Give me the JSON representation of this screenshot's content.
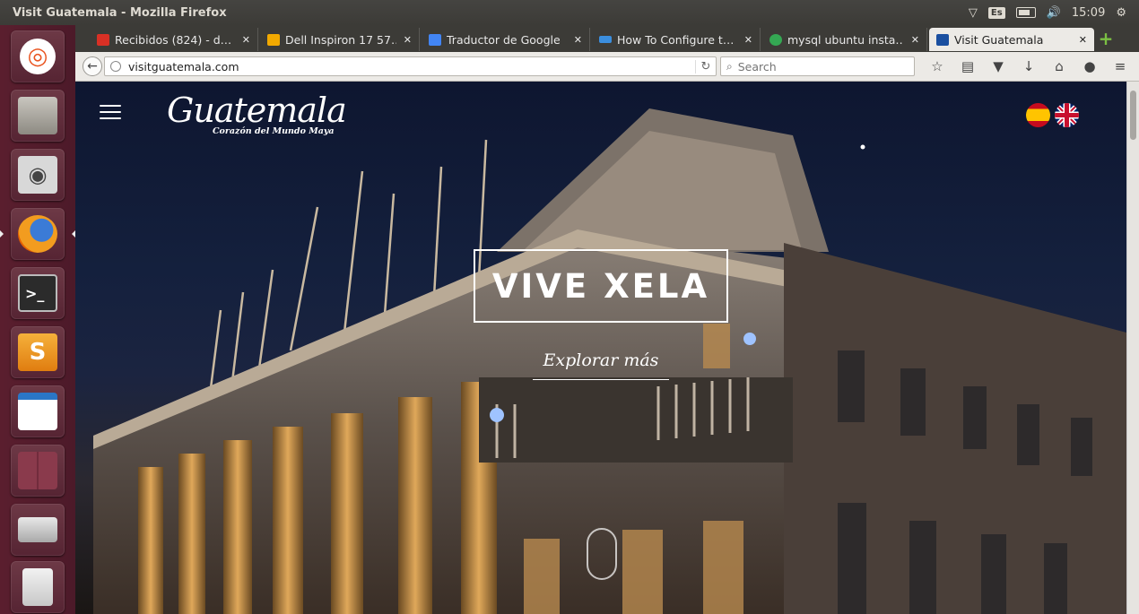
{
  "os": {
    "window_title": "Visit Guatemala - Mozilla Firefox",
    "keyboard_layout": "Es",
    "clock": "15:09",
    "launcher_colors": [
      "#e95420",
      "#8d8a82",
      "#d8d8d8",
      "#e66000",
      "#2b2b2b",
      "#f29c1f",
      "#2a76c6",
      "#8a3a4c",
      "#cfcfcf",
      "#e5e5e5"
    ]
  },
  "browser": {
    "tabs": [
      {
        "label": "Recibidos (824) - d…",
        "favicon_color": "#d93025"
      },
      {
        "label": "Dell Inspiron 17 57…",
        "favicon_color": "#f2a900"
      },
      {
        "label": "Traductor de Google",
        "favicon_color": "#4285f4"
      },
      {
        "label": "How To Configure t…",
        "favicon_color": "#3b8ede"
      },
      {
        "label": "mysql ubuntu insta…",
        "favicon_color": "#34a853"
      },
      {
        "label": "Visit Guatemala",
        "favicon_color": "#1a4fa0",
        "selected": true
      }
    ],
    "url": "visitguatemala.com",
    "search_placeholder": "Search",
    "toolbar_icons": [
      "star-icon",
      "reading-list-icon",
      "pocket-icon",
      "download-icon",
      "home-icon",
      "chat-icon",
      "menu-icon"
    ]
  },
  "page": {
    "logo_text": "Guatemala",
    "logo_tagline": "Corazón del Mundo Maya",
    "hero_title": "VIVE XELA",
    "explore_link": "Explorar más",
    "languages": [
      "es",
      "en"
    ]
  }
}
